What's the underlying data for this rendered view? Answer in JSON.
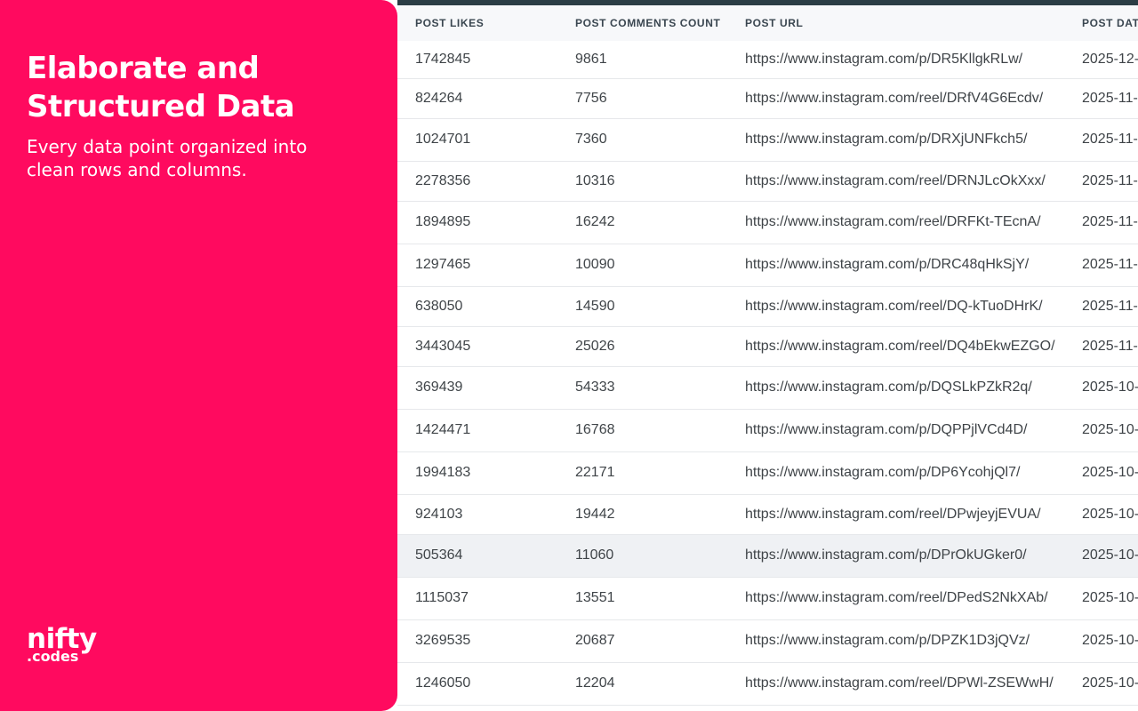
{
  "promo": {
    "title": "Elaborate and Structured Data",
    "subtitle": "Every data point organized into clean rows and columns.",
    "logo_main": "nifty",
    "logo_sub": ".codes"
  },
  "table": {
    "columns": [
      "POST LIKES",
      "POST COMMENTS COUNT",
      "POST URL",
      "POST DAT"
    ],
    "rows": [
      {
        "likes": "1742845",
        "comments": "9861",
        "url": "https://www.instagram.com/p/DR5KllgkRLw/",
        "date": "2025-12-"
      },
      {
        "likes": "824264",
        "comments": "7756",
        "url": "https://www.instagram.com/reel/DRfV4G6Ecdv/",
        "date": "2025-11-"
      },
      {
        "likes": "1024701",
        "comments": "7360",
        "url": "https://www.instagram.com/p/DRXjUNFkch5/",
        "date": "2025-11-"
      },
      {
        "likes": "2278356",
        "comments": "10316",
        "url": "https://www.instagram.com/reel/DRNJLcOkXxx/",
        "date": "2025-11-"
      },
      {
        "likes": "1894895",
        "comments": "16242",
        "url": "https://www.instagram.com/reel/DRFKt-TEcnA/",
        "date": "2025-11-"
      },
      {
        "likes": "1297465",
        "comments": "10090",
        "url": "https://www.instagram.com/p/DRC48qHkSjY/",
        "date": "2025-11-"
      },
      {
        "likes": "638050",
        "comments": "14590",
        "url": "https://www.instagram.com/reel/DQ-kTuoDHrK/",
        "date": "2025-11-"
      },
      {
        "likes": "3443045",
        "comments": "25026",
        "url": "https://www.instagram.com/reel/DQ4bEkwEZGO/",
        "date": "2025-11-"
      },
      {
        "likes": "369439",
        "comments": "54333",
        "url": "https://www.instagram.com/p/DQSLkPZkR2q/",
        "date": "2025-10-"
      },
      {
        "likes": "1424471",
        "comments": "16768",
        "url": "https://www.instagram.com/p/DQPPjlVCd4D/",
        "date": "2025-10-"
      },
      {
        "likes": "1994183",
        "comments": "22171",
        "url": "https://www.instagram.com/p/DP6YcohjQl7/",
        "date": "2025-10-"
      },
      {
        "likes": "924103",
        "comments": "19442",
        "url": "https://www.instagram.com/reel/DPwjeyjEVUA/",
        "date": "2025-10-"
      },
      {
        "likes": "505364",
        "comments": "11060",
        "url": "https://www.instagram.com/p/DPrOkUGker0/",
        "date": "2025-10-"
      },
      {
        "likes": "1115037",
        "comments": "13551",
        "url": "https://www.instagram.com/reel/DPedS2NkXAb/",
        "date": "2025-10-"
      },
      {
        "likes": "3269535",
        "comments": "20687",
        "url": "https://www.instagram.com/p/DPZK1D3jQVz/",
        "date": "2025-10-"
      },
      {
        "likes": "1246050",
        "comments": "12204",
        "url": "https://www.instagram.com/reel/DPWl-ZSEWwH/",
        "date": "2025-10-"
      }
    ]
  },
  "colors": {
    "brand": "#ff0a5f",
    "header_bar": "#2b3d45",
    "row_highlight": "#eff1f4"
  }
}
